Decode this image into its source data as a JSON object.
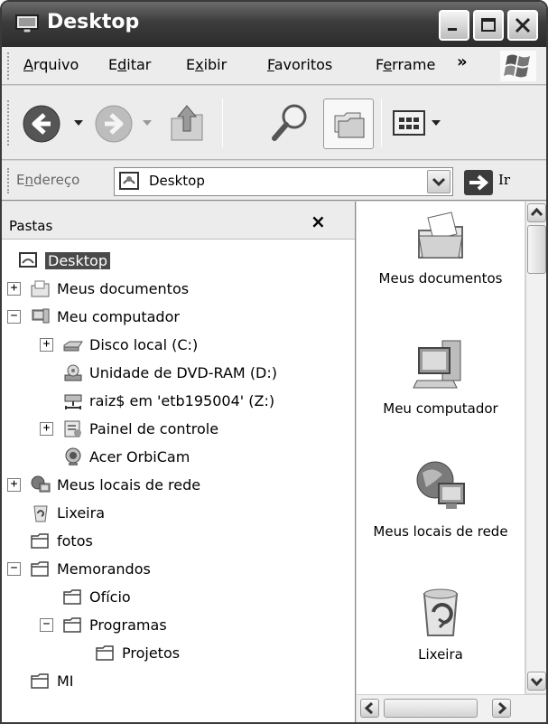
{
  "window": {
    "title": "Desktop"
  },
  "menu": [
    {
      "label": "Arquivo",
      "accel": "A",
      "rest": "rquivo"
    },
    {
      "label": "Editar",
      "pre": "E",
      "accel": "d",
      "rest": "itar"
    },
    {
      "label": "Exibir",
      "pre": "E",
      "accel": "x",
      "rest": "ibir"
    },
    {
      "label": "Favoritos",
      "accel": "F",
      "rest": "avoritos"
    },
    {
      "label": "Ferrame",
      "pre": "F",
      "accel": "e",
      "rest": "rrame"
    }
  ],
  "menu_overflow": "»",
  "address": {
    "label_pre": "E",
    "label_accel": "n",
    "label_rest": "dereço",
    "value": "Desktop",
    "go_label": "Ir"
  },
  "folders_pane": {
    "title": "Pastas",
    "close": "×",
    "tree": [
      {
        "label": "Desktop",
        "icon": "desktop-icon",
        "level": 0,
        "expander": "",
        "selected": true
      },
      {
        "label": "Meus documentos",
        "icon": "my-documents-icon",
        "level": 1,
        "expander": "+"
      },
      {
        "label": "Meu computador",
        "icon": "my-computer-icon",
        "level": 1,
        "expander": "−"
      },
      {
        "label": "Disco local (C:)",
        "icon": "hard-disk-icon",
        "level": 2,
        "expander": "+"
      },
      {
        "label": "Unidade de DVD-RAM (D:)",
        "icon": "dvd-drive-icon",
        "level": 2,
        "expander": ""
      },
      {
        "label": "raiz$ em 'etb195004' (Z:)",
        "icon": "network-drive-icon",
        "level": 2,
        "expander": ""
      },
      {
        "label": "Painel de controle",
        "icon": "control-panel-icon",
        "level": 2,
        "expander": "+"
      },
      {
        "label": "Acer OrbiCam",
        "icon": "webcam-icon",
        "level": 2,
        "expander": ""
      },
      {
        "label": "Meus locais de rede",
        "icon": "network-places-icon",
        "level": 1,
        "expander": "+"
      },
      {
        "label": "Lixeira",
        "icon": "recycle-bin-icon",
        "level": 1,
        "expander": ""
      },
      {
        "label": "fotos",
        "icon": "folder-icon",
        "level": 1,
        "expander": ""
      },
      {
        "label": "Memorandos",
        "icon": "folder-icon",
        "level": 1,
        "expander": "−"
      },
      {
        "label": "Ofício",
        "icon": "folder-icon",
        "level": 2,
        "expander": ""
      },
      {
        "label": "Programas",
        "icon": "folder-icon",
        "level": 2,
        "expander": "−"
      },
      {
        "label": "Projetos",
        "icon": "folder-icon",
        "level": 3,
        "expander": ""
      },
      {
        "label": "MI",
        "icon": "folder-icon",
        "level": 1,
        "expander": ""
      }
    ]
  },
  "right_pane": [
    {
      "caption": "Meus documentos",
      "icon": "my-documents-icon"
    },
    {
      "caption": "Meu computador",
      "icon": "my-computer-icon"
    },
    {
      "caption": "Meus locais de rede",
      "icon": "network-places-icon"
    },
    {
      "caption": "Lixeira",
      "icon": "recycle-bin-icon"
    }
  ]
}
